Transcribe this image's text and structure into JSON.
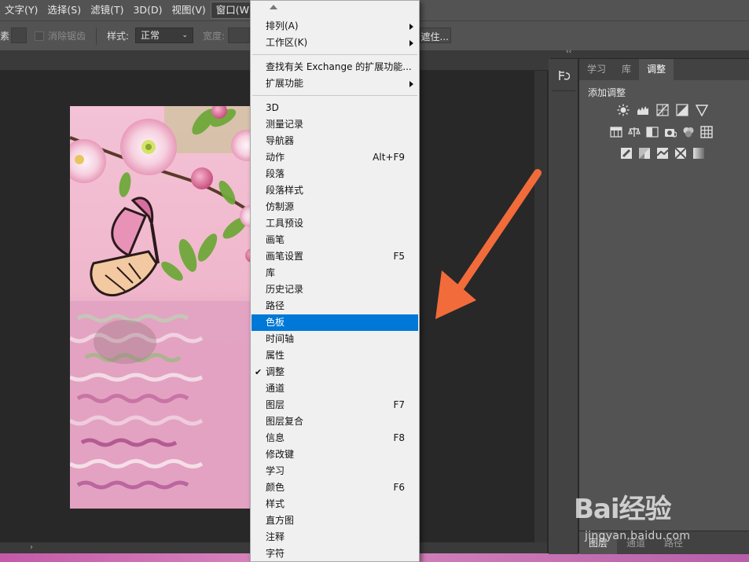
{
  "menubar": {
    "items": [
      "文字(Y)",
      "选择(S)",
      "滤镜(T)",
      "3D(D)",
      "视图(V)",
      "窗口(W)"
    ],
    "active_index": 5
  },
  "optbar": {
    "partial_label": "素",
    "antialias_label": "消除锯齿",
    "style_label": "样式:",
    "style_value": "正常",
    "width_label": "宽度:",
    "button_partial": "选择并遮住..."
  },
  "dock": {
    "collapse_glyph": "‹‹",
    "tabs": [
      "学习",
      "库",
      "调整"
    ],
    "active_tab_index": 2,
    "panel_title": "添加调整",
    "bottom_tabs": [
      "图层",
      "通道",
      "路径"
    ],
    "active_bottom_index": 0
  },
  "dropdown": {
    "items": [
      {
        "label": "排列(A)",
        "submenu": true
      },
      {
        "label": "工作区(K)",
        "submenu": true
      },
      {
        "label": "查找有关 Exchange 的扩展功能...",
        "sep_before": true
      },
      {
        "label": "扩展功能",
        "submenu": true
      },
      {
        "label": "3D",
        "sep_before": true
      },
      {
        "label": "测量记录"
      },
      {
        "label": "导航器"
      },
      {
        "label": "动作",
        "shortcut": "Alt+F9"
      },
      {
        "label": "段落"
      },
      {
        "label": "段落样式"
      },
      {
        "label": "仿制源"
      },
      {
        "label": "工具预设"
      },
      {
        "label": "画笔"
      },
      {
        "label": "画笔设置",
        "shortcut": "F5"
      },
      {
        "label": "库"
      },
      {
        "label": "历史记录"
      },
      {
        "label": "路径"
      },
      {
        "label": "色板",
        "highlighted": true
      },
      {
        "label": "时间轴"
      },
      {
        "label": "属性"
      },
      {
        "label": "调整",
        "checked": true
      },
      {
        "label": "通道"
      },
      {
        "label": "图层",
        "shortcut": "F7"
      },
      {
        "label": "图层复合"
      },
      {
        "label": "信息",
        "shortcut": "F8"
      },
      {
        "label": "修改键"
      },
      {
        "label": "学习"
      },
      {
        "label": "颜色",
        "shortcut": "F6"
      },
      {
        "label": "样式"
      },
      {
        "label": "直方图"
      },
      {
        "label": "注释"
      },
      {
        "label": "字符"
      }
    ],
    "check_glyph": "✔"
  },
  "annotation": {
    "arrow_color": "#f26b3a"
  },
  "watermark": {
    "brand": "Bai经验",
    "url": "jingyan.baidu.com"
  },
  "colors": {
    "highlight": "#0078d7",
    "menu_bg": "#f0f0f0",
    "ui_dark": "#535353"
  }
}
